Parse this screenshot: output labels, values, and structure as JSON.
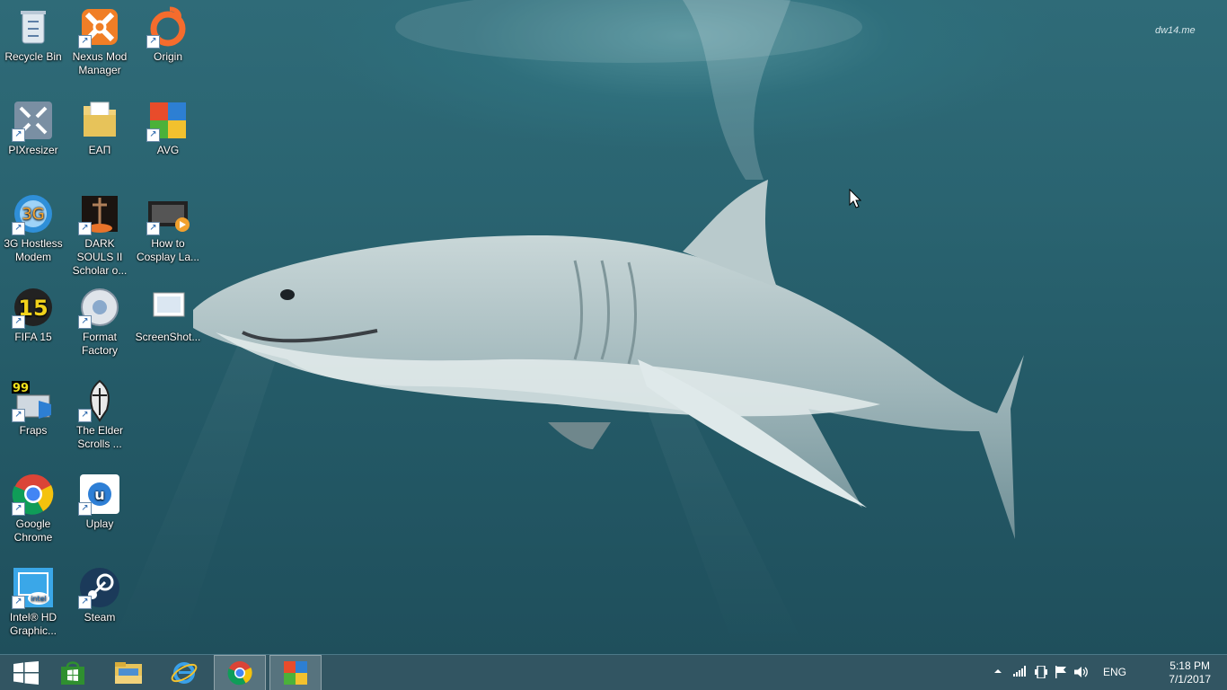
{
  "desktop": {
    "watermark": "dw14.me",
    "icons": [
      {
        "label": "Recycle Bin",
        "icon": "recycle-bin-icon"
      },
      {
        "label": "Nexus Mod Manager",
        "icon": "nexus-mod-manager-icon"
      },
      {
        "label": "Origin",
        "icon": "origin-icon"
      },
      {
        "label": "PIXresizer",
        "icon": "pixresizer-icon"
      },
      {
        "label": "ΕΑΠ",
        "icon": "folder-icon"
      },
      {
        "label": "AVG",
        "icon": "avg-icon"
      },
      {
        "label": "3G Hostless Modem",
        "icon": "modem-icon"
      },
      {
        "label": "DARK SOULS II Scholar o...",
        "icon": "dark-souls-icon"
      },
      {
        "label": "How to Cosplay La...",
        "icon": "video-file-icon"
      },
      {
        "label": "FIFA 15",
        "icon": "fifa-icon"
      },
      {
        "label": "Format Factory",
        "icon": "format-factory-icon"
      },
      {
        "label": "ScreenShot...",
        "icon": "screenshot-file-icon"
      },
      {
        "label": "Fraps",
        "icon": "fraps-icon"
      },
      {
        "label": "The Elder Scrolls ...",
        "icon": "skyrim-icon"
      },
      {
        "label": "Google Chrome",
        "icon": "chrome-icon"
      },
      {
        "label": "Uplay",
        "icon": "uplay-icon"
      },
      {
        "label": "Intel® HD Graphic...",
        "icon": "intel-graphics-icon"
      },
      {
        "label": "Steam",
        "icon": "steam-icon"
      }
    ]
  },
  "taskbar": {
    "buttons": [
      {
        "name": "start",
        "icon": "windows-start-icon"
      },
      {
        "name": "store",
        "icon": "store-icon"
      },
      {
        "name": "file-explorer",
        "icon": "file-explorer-icon"
      },
      {
        "name": "internet-explorer",
        "icon": "internet-explorer-icon"
      },
      {
        "name": "chrome",
        "icon": "chrome-icon"
      },
      {
        "name": "avg",
        "icon": "avg-icon"
      }
    ],
    "tray": {
      "language": "ENG",
      "time": "5:18 PM",
      "date": "7/1/2017"
    }
  },
  "colors": {
    "taskbar": "#2a4e5c",
    "water": "#2a6471"
  }
}
